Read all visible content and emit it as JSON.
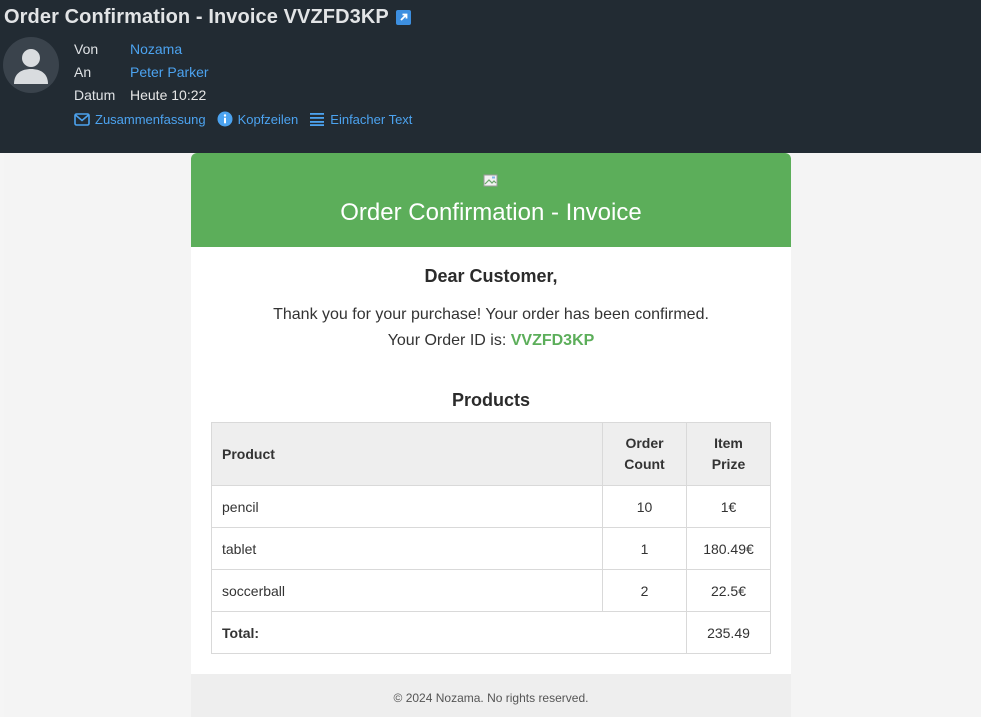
{
  "header": {
    "title": "Order Confirmation - Invoice VVZFD3KP",
    "fields": [
      {
        "label": "Von",
        "value": "Nozama"
      },
      {
        "label": "An",
        "value": "Peter Parker"
      },
      {
        "label": "Datum",
        "value": "Heute 10:22"
      }
    ],
    "views": {
      "summary": "Zusammenfassung",
      "headers": "Kopfzeilen",
      "plain": "Einfacher Text"
    }
  },
  "email": {
    "banner_title": "Order Confirmation - Invoice",
    "greeting": "Dear Customer,",
    "message": "Thank you for your purchase! Your order has been confirmed.",
    "order_id_label": "Your Order ID is:",
    "order_id": "VVZFD3KP",
    "products_title": "Products",
    "table": {
      "headers": {
        "product": "Product",
        "count_line1": "Order",
        "count_line2": "Count",
        "prize_line1": "Item",
        "prize_line2": "Prize"
      },
      "rows": [
        {
          "product": "pencil",
          "count": "10",
          "prize": "1€"
        },
        {
          "product": "tablet",
          "count": "1",
          "prize": "180.49€"
        },
        {
          "product": "soccerball",
          "count": "2",
          "prize": "22.5€"
        }
      ],
      "total_label": "Total:",
      "total_value": "235.49"
    },
    "footer": "© 2024 Nozama. No rights reserved."
  },
  "colors": {
    "header_bg": "#222b33",
    "link": "#4ca3f0",
    "brand_green": "#5cae5a"
  },
  "icons": {
    "external": "external-link-icon",
    "avatar": "user-avatar-icon",
    "summary": "envelope-icon",
    "headers": "info-icon",
    "plain": "lines-icon",
    "logo": "broken-image-icon"
  }
}
